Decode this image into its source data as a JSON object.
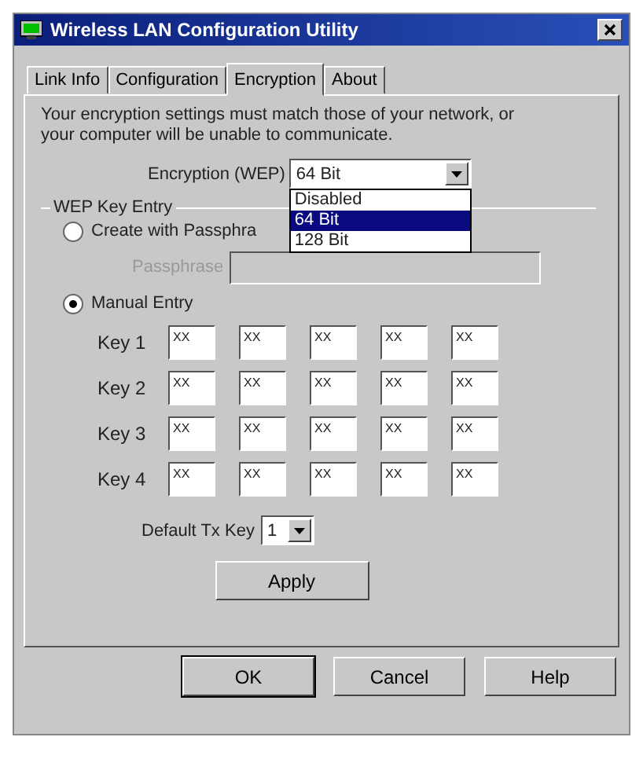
{
  "window": {
    "title": "Wireless LAN Configuration Utility"
  },
  "tabs": [
    {
      "label": "Link Info",
      "selected": false
    },
    {
      "label": "Configuration",
      "selected": false
    },
    {
      "label": "Encryption",
      "selected": true
    },
    {
      "label": "About",
      "selected": false
    }
  ],
  "notice": "Your encryption settings must match those of your network, or your computer will be unable to communicate.",
  "encryption": {
    "label": "Encryption (WEP)",
    "value": "64 Bit",
    "expanded": true,
    "options": [
      {
        "label": "Disabled",
        "selected": false
      },
      {
        "label": "64 Bit",
        "selected": true
      },
      {
        "label": "128 Bit",
        "selected": false
      }
    ]
  },
  "wep_group": {
    "title": "WEP Key Entry",
    "modes": [
      {
        "label": "Create with Passphra",
        "selected": false
      },
      {
        "label": "Manual Entry",
        "selected": true
      }
    ],
    "passphrase": {
      "label": "Passphrase",
      "disabled": true
    },
    "keys": [
      {
        "label": "Key 1",
        "values": [
          "XX",
          "XX",
          "XX",
          "XX",
          "XX"
        ]
      },
      {
        "label": "Key 2",
        "values": [
          "XX",
          "XX",
          "XX",
          "XX",
          "XX"
        ]
      },
      {
        "label": "Key 3",
        "values": [
          "XX",
          "XX",
          "XX",
          "XX",
          "XX"
        ]
      },
      {
        "label": "Key 4",
        "values": [
          "XX",
          "XX",
          "XX",
          "XX",
          "XX"
        ]
      }
    ]
  },
  "default_tx_key": {
    "label": "Default Tx Key",
    "value": "1"
  },
  "apply_button": "Apply",
  "buttons": [
    "OK",
    "Cancel",
    "Help"
  ]
}
